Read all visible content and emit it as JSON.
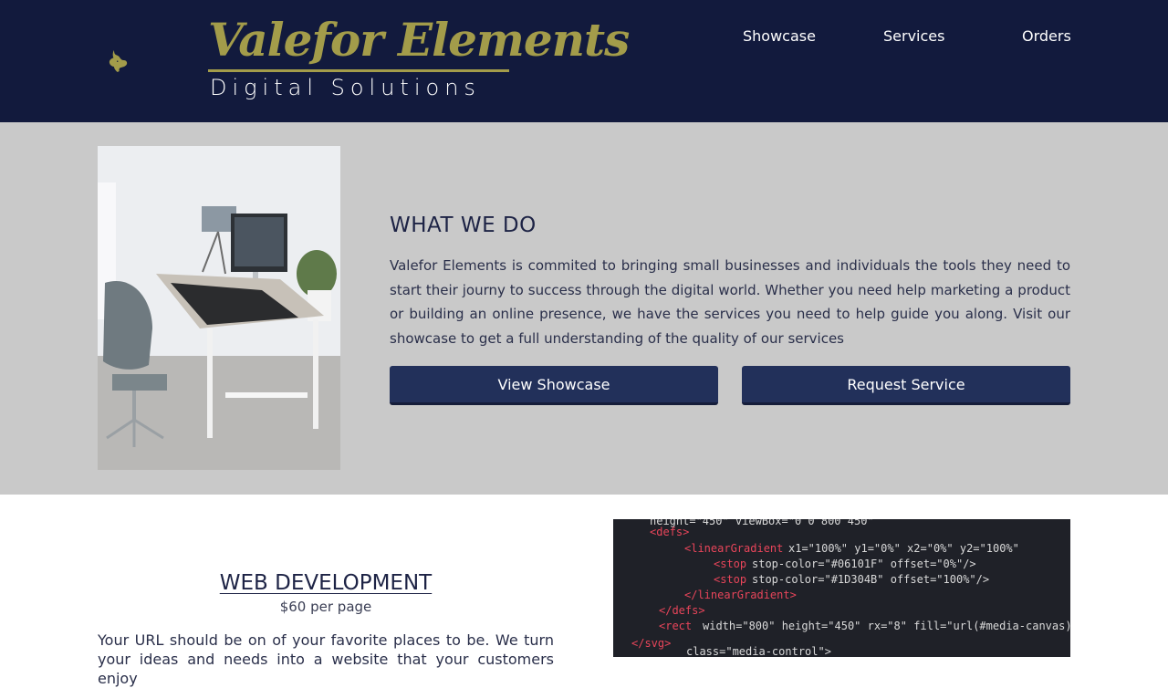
{
  "header": {
    "brand_title": "Valefor Elements",
    "brand_subtitle": "Digital Solutions",
    "nav": [
      "Showcase",
      "Services",
      "Orders"
    ]
  },
  "about": {
    "title": "WHAT WE DO",
    "text": "Valefor Elements is commited to bringing small businesses and individuals the tools they need to start their journy to success through the digital world. Whether you need help marketing a product or building an online presence, we have the services you need to help guide you along. Visit our showcase to get a full understanding of the quality of our services",
    "buttons": {
      "view_showcase": "View Showcase",
      "request_service": "Request Service"
    }
  },
  "webdev": {
    "title": "WEB DEVELOPMENT",
    "price": "$60 per page",
    "text": "Your URL should be on of your favorite places to be. We turn your ideas and needs into a website that your customers enjoy"
  },
  "colors": {
    "header_bg": "#121a3d",
    "brand_gold": "#a39c4a",
    "about_bg": "#c9c9c9",
    "button_bg": "#22305a"
  }
}
